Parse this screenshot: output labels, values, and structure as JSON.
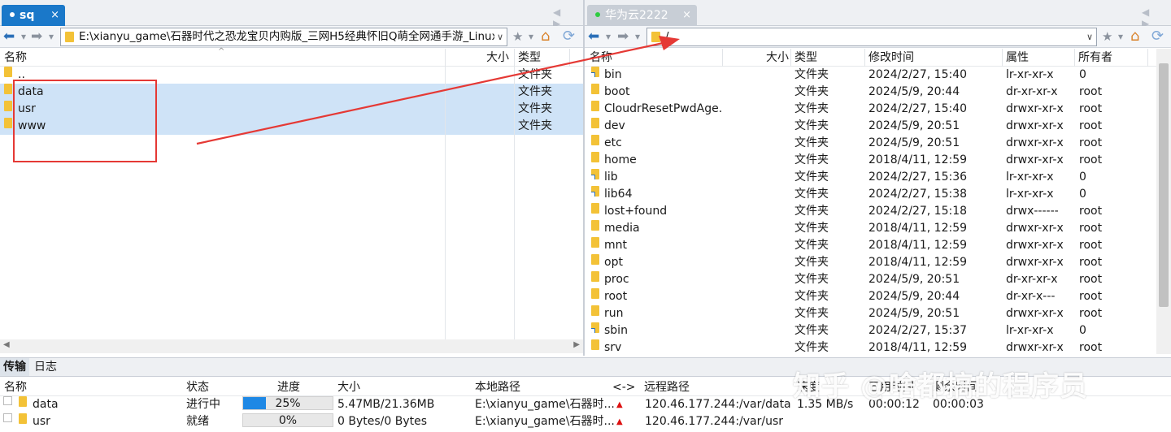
{
  "left_tab": {
    "label": "sq",
    "close": "×"
  },
  "right_tab": {
    "label": "华为云2222",
    "close": "×"
  },
  "tab_nav": "◀ ▶",
  "left_path": "E:\\xianyu_game\\石器时代之恐龙宝贝内购版_三网H5经典怀旧Q萌全网通手游_Linux",
  "right_path": "/",
  "dropdown": "∨",
  "nav": {
    "back": "⬅",
    "forward": "➡",
    "menu": "▾",
    "fav": "★",
    "home": "⌂",
    "refresh": "⟳"
  },
  "left_headers": {
    "name": "名称",
    "size": "大小",
    "type": "类型"
  },
  "left_rows": [
    {
      "name": "..",
      "type": "文件夹",
      "selected": false
    },
    {
      "name": "data",
      "type": "文件夹",
      "selected": true
    },
    {
      "name": "usr",
      "type": "文件夹",
      "selected": true
    },
    {
      "name": "www",
      "type": "文件夹",
      "selected": true
    }
  ],
  "right_headers": {
    "name": "名称",
    "size": "大小",
    "type": "类型",
    "mtime": "修改时间",
    "attr": "属性",
    "owner": "所有者"
  },
  "right_rows": [
    {
      "name": "bin",
      "type": "文件夹",
      "mtime": "2024/2/27, 15:40",
      "attr": "lr-xr-xr-x",
      "owner": "0",
      "link": true
    },
    {
      "name": "boot",
      "type": "文件夹",
      "mtime": "2024/5/9, 20:44",
      "attr": "dr-xr-xr-x",
      "owner": "root",
      "link": false
    },
    {
      "name": "CloudrResetPwdAge...",
      "type": "文件夹",
      "mtime": "2024/2/27, 15:40",
      "attr": "drwxr-xr-x",
      "owner": "root",
      "link": false
    },
    {
      "name": "dev",
      "type": "文件夹",
      "mtime": "2024/5/9, 20:51",
      "attr": "drwxr-xr-x",
      "owner": "root",
      "link": false
    },
    {
      "name": "etc",
      "type": "文件夹",
      "mtime": "2024/5/9, 20:51",
      "attr": "drwxr-xr-x",
      "owner": "root",
      "link": false
    },
    {
      "name": "home",
      "type": "文件夹",
      "mtime": "2018/4/11, 12:59",
      "attr": "drwxr-xr-x",
      "owner": "root",
      "link": false
    },
    {
      "name": "lib",
      "type": "文件夹",
      "mtime": "2024/2/27, 15:36",
      "attr": "lr-xr-xr-x",
      "owner": "0",
      "link": true
    },
    {
      "name": "lib64",
      "type": "文件夹",
      "mtime": "2024/2/27, 15:38",
      "attr": "lr-xr-xr-x",
      "owner": "0",
      "link": true
    },
    {
      "name": "lost+found",
      "type": "文件夹",
      "mtime": "2024/2/27, 15:18",
      "attr": "drwx------",
      "owner": "root",
      "link": false
    },
    {
      "name": "media",
      "type": "文件夹",
      "mtime": "2018/4/11, 12:59",
      "attr": "drwxr-xr-x",
      "owner": "root",
      "link": false
    },
    {
      "name": "mnt",
      "type": "文件夹",
      "mtime": "2018/4/11, 12:59",
      "attr": "drwxr-xr-x",
      "owner": "root",
      "link": false
    },
    {
      "name": "opt",
      "type": "文件夹",
      "mtime": "2018/4/11, 12:59",
      "attr": "drwxr-xr-x",
      "owner": "root",
      "link": false
    },
    {
      "name": "proc",
      "type": "文件夹",
      "mtime": "2024/5/9, 20:51",
      "attr": "dr-xr-xr-x",
      "owner": "root",
      "link": false
    },
    {
      "name": "root",
      "type": "文件夹",
      "mtime": "2024/5/9, 20:44",
      "attr": "dr-xr-x---",
      "owner": "root",
      "link": false
    },
    {
      "name": "run",
      "type": "文件夹",
      "mtime": "2024/5/9, 20:51",
      "attr": "drwxr-xr-x",
      "owner": "root",
      "link": false
    },
    {
      "name": "sbin",
      "type": "文件夹",
      "mtime": "2024/2/27, 15:37",
      "attr": "lr-xr-xr-x",
      "owner": "0",
      "link": true
    },
    {
      "name": "srv",
      "type": "文件夹",
      "mtime": "2018/4/11, 12:59",
      "attr": "drwxr-xr-x",
      "owner": "root",
      "link": false
    }
  ],
  "bottom_tabs": {
    "transfer": "传输",
    "log": "日志"
  },
  "transfer_headers": {
    "name": "名称",
    "status": "状态",
    "progress": "进度",
    "size": "大小",
    "local": "本地路径",
    "dir": "<->",
    "remote": "远程路径",
    "speed": "速度",
    "elapsed": "已用时间",
    "remain": "剩余时间"
  },
  "transfers": [
    {
      "name": "data",
      "status": "进行中",
      "progress_label": "25%",
      "progress": 0.25,
      "size": "5.47MB/21.36MB",
      "local": "E:\\xianyu_game\\石器时...",
      "remote": "120.46.177.244:/var/data",
      "speed": "1.35 MB/s",
      "elapsed": "00:00:12",
      "remain": "00:00:03"
    },
    {
      "name": "usr",
      "status": "就绪",
      "progress_label": "0%",
      "progress": 0,
      "size": "0 Bytes/0 Bytes",
      "local": "E:\\xianyu_game\\石器时...",
      "remote": "120.46.177.244:/var/usr",
      "speed": "",
      "elapsed": "",
      "remain": ""
    }
  ],
  "watermark": "知乎 @啥都搞的程序员",
  "colors": {
    "accent": "#1a78c9",
    "selection": "#cfe3f7",
    "folder": "#f3c237",
    "annotation": "#e53935",
    "progress": "#1e88e5"
  }
}
